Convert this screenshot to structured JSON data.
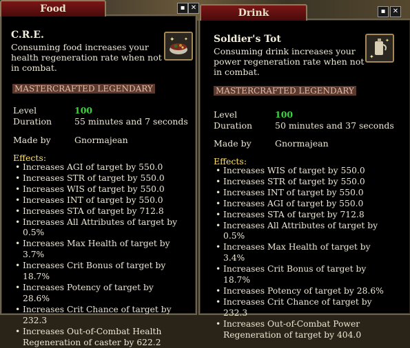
{
  "food": {
    "tab_title": "Food",
    "item_name": "C.R.E.",
    "description": "Consuming food increases your health regeneration rate when not in combat.",
    "rarity": "MASTERCRAFTED LEGENDARY",
    "icon": "food-bowl-icon",
    "level_label": "Level",
    "level_value": "100",
    "duration_label": "Duration",
    "duration_value": "55 minutes and 7 seconds",
    "made_by_label": "Made by",
    "made_by_value": "Gnormajean",
    "effects_label": "Effects:",
    "effects": [
      "Increases AGI of target by 550.0",
      "Increases STR of target by 550.0",
      "Increases WIS of target by 550.0",
      "Increases INT of target by 550.0",
      "Increases STA of target by 712.8",
      "Increases All Attributes of target by 0.5%",
      "Increases Max Health of target by 3.7%",
      "Increases Crit Bonus of target by 18.7%",
      "Increases Potency of target by 28.6%",
      "Increases Crit Chance of target by 232.3",
      "Increases Out-of-Combat Health Regeneration of caster by 622.2"
    ]
  },
  "drink": {
    "tab_title": "Drink",
    "item_name": "Soldier's Tot",
    "description": "Consuming drink increases your power regeneration rate when not in combat.",
    "rarity": "MASTERCRAFTED LEGENDARY",
    "icon": "drink-flask-icon",
    "level_label": "Level",
    "level_value": "100",
    "duration_label": "Duration",
    "duration_value": "50 minutes and 37 seconds",
    "made_by_label": "Made by",
    "made_by_value": "Gnormajean",
    "effects_label": "Effects:",
    "effects": [
      "Increases WIS of target by 550.0",
      "Increases STR of target by 550.0",
      "Increases INT of target by 550.0",
      "Increases AGI of target by 550.0",
      "Increases STA of target by 712.8",
      "Increases All Attributes of target by 0.5%",
      "Increases Max Health of target by 3.4%",
      "Increases Crit Bonus of target by 18.7%",
      "Increases Potency of target by 28.6%",
      "Increases Crit Chance of target by 232.3",
      "Increases Out-of-Combat Power Regeneration of target by 404.0"
    ]
  },
  "buttons": {
    "restore_glyph": "▪",
    "close_glyph": "✕"
  },
  "colors": {
    "level_value": "#3ed33e",
    "effects_header": "#ffe16a",
    "rarity_text": "#e7b9a6",
    "title_tab": "#7a1616"
  }
}
